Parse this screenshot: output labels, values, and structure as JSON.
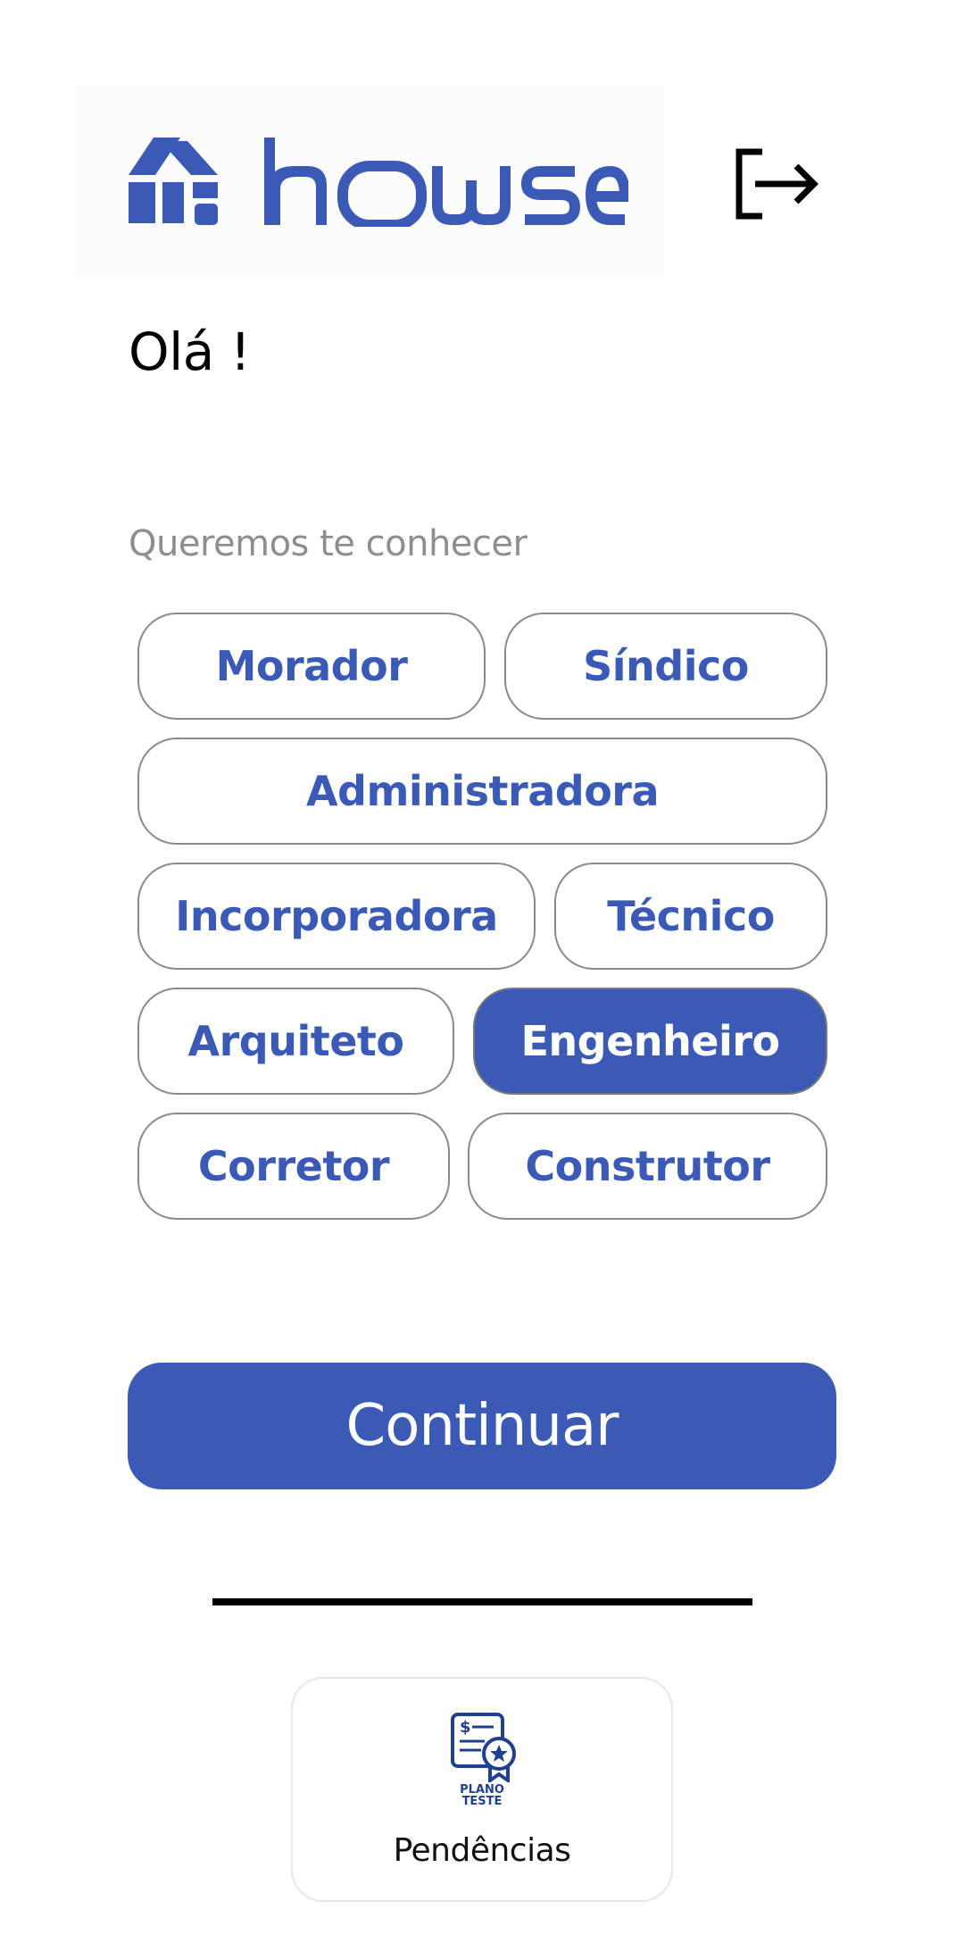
{
  "brand": {
    "name": "howse",
    "color": "#3a5ab5"
  },
  "header": {
    "logout_icon": "logout-icon"
  },
  "greeting": "Olá !",
  "subtitle": "Queremos te conhecer",
  "roles": [
    {
      "label": "Morador",
      "selected": false
    },
    {
      "label": "Síndico",
      "selected": false
    },
    {
      "label": "Administradora",
      "selected": false
    },
    {
      "label": "Incorporadora",
      "selected": false
    },
    {
      "label": "Técnico",
      "selected": false
    },
    {
      "label": "Arquiteto",
      "selected": false
    },
    {
      "label": "Engenheiro",
      "selected": true
    },
    {
      "label": "Corretor",
      "selected": false
    },
    {
      "label": "Construtor",
      "selected": false
    }
  ],
  "continue_label": "Continuar",
  "bottom_card": {
    "badge_line1": "PLANO",
    "badge_line2": "TESTE",
    "label": "Pendências",
    "icon": "certificate-icon"
  }
}
